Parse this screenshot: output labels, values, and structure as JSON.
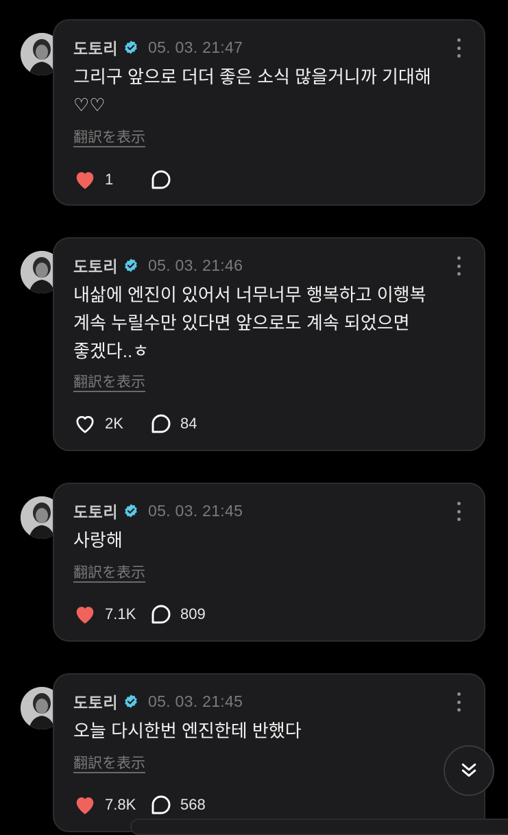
{
  "posts": [
    {
      "author": "도토리",
      "timestamp": "05. 03. 21:47",
      "text": "그리구 앞으로 더더 좋은 소식 많을거니까 기대해\n♡♡",
      "translate_label": "翻訳を表示",
      "likes": "1",
      "liked": true,
      "comments": ""
    },
    {
      "author": "도토리",
      "timestamp": "05. 03. 21:46",
      "text": "내삶에 엔진이 있어서 너무너무 행복하고 이행복\n계속 누릴수만 있다면 앞으로도 계속 되었으면\n좋겠다..ㅎ",
      "translate_label": "翻訳を表示",
      "likes": "2K",
      "liked": false,
      "comments": "84"
    },
    {
      "author": "도토리",
      "timestamp": "05. 03. 21:45",
      "text": "사랑해",
      "translate_label": "翻訳を表示",
      "likes": "7.1K",
      "liked": true,
      "comments": "809"
    },
    {
      "author": "도토리",
      "timestamp": "05. 03. 21:45",
      "text": "오늘 다시한번 엔진한테 반했다",
      "translate_label": "翻訳を表示",
      "likes": "7.8K",
      "liked": true,
      "comments": "568"
    }
  ],
  "icons": {
    "verified": "verified-badge-icon",
    "more": "more-vertical-icon",
    "like": "heart-icon",
    "comment": "comment-bubble-icon",
    "scroll_down": "double-chevron-down-icon"
  },
  "colors": {
    "background": "#000000",
    "card": "#1c1c1e",
    "liked_heart": "#f0635d",
    "verified": "#5ac8e8",
    "muted_text": "#7a7a7a"
  }
}
